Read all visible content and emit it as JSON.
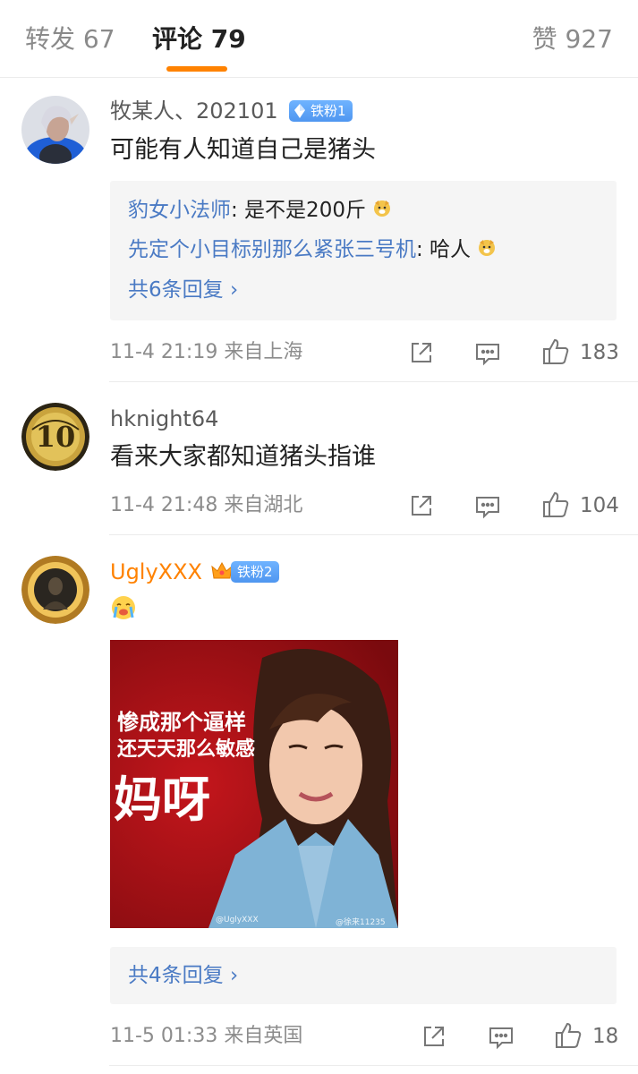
{
  "tabs": {
    "repost_label": "转发 67",
    "comment_label": "评论 79",
    "like_label": "赞 927"
  },
  "comments": [
    {
      "username": "牧某人、202101",
      "badge": "铁粉1",
      "text": "可能有人知道自己是猪头",
      "replies": [
        {
          "user": "豹女小法师",
          "text": ": 是不是200斤"
        },
        {
          "user": "先定个小目标别那么紧张三号机",
          "text": ": 哈人"
        }
      ],
      "more_replies": "共6条回复 ›",
      "meta": "11-4 21:19  来自上海",
      "likes": "183"
    },
    {
      "username": "hknight64",
      "text": "看来大家都知道猪头指谁",
      "meta": "11-4 21:48  来自湖北",
      "likes": "104"
    },
    {
      "username": "UglyXXX",
      "badge": "铁粉2",
      "image": {
        "caption_line1": "惨成那个逼样",
        "caption_line2": "还天天那么敏感",
        "caption_line3": "妈呀",
        "watermark_left": "@UglyXXX",
        "watermark_right": "@徐来11235"
      },
      "more_replies": "共4条回复 ›",
      "meta": "11-5 01:33  来自英国",
      "likes": "18"
    }
  ],
  "colors": {
    "accent": "#ff8200",
    "link": "#4a7ac4",
    "badge": "#5aa2f5",
    "meta": "#8c8c8c"
  },
  "icons": [
    "share-icon",
    "comment-icon",
    "thumb-up-icon",
    "diamond-icon",
    "crown-icon",
    "shiba-emoji",
    "crying-emoji"
  ]
}
